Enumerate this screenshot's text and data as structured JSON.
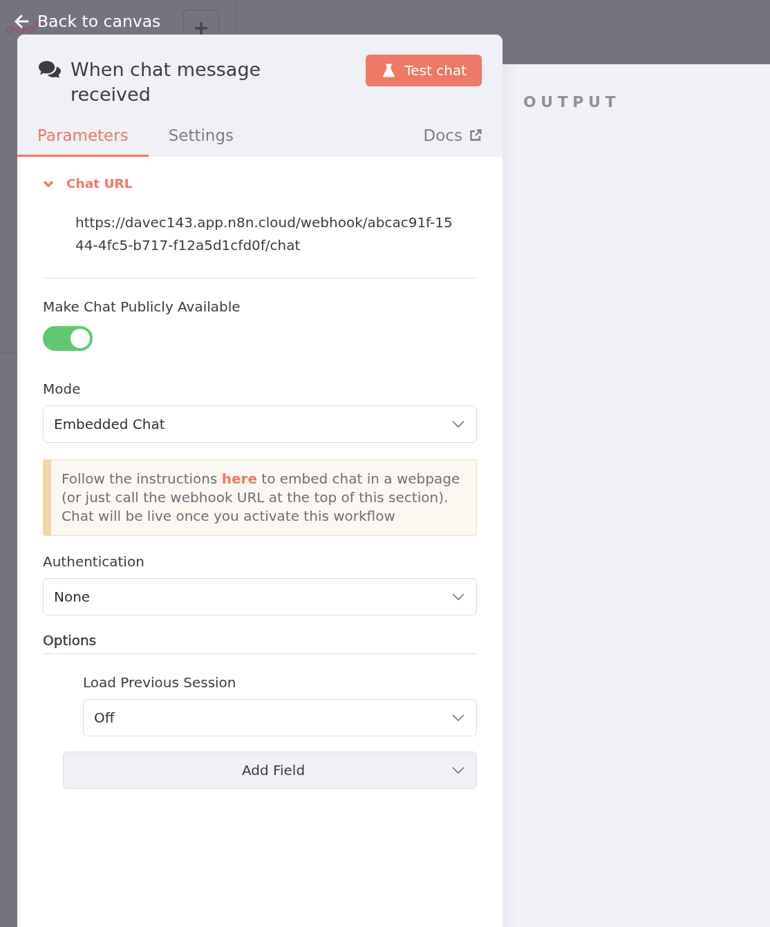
{
  "top_bar": {
    "back_link": "Back to canvas"
  },
  "node": {
    "title": "When chat message received",
    "test_button": "Test chat",
    "tabs": [
      {
        "label": "Parameters",
        "selected": true
      },
      {
        "label": "Settings",
        "selected": false
      }
    ],
    "docs_link": "Docs"
  },
  "parameters": {
    "chat_url": {
      "label": "Chat URL",
      "expanded": true,
      "url": "https://davec143.app.n8n.cloud/webhook/abcac91f-1544-4fc5-b717-f12a5d1cfd0f/chat"
    },
    "fields": [
      {
        "kind": "toggle",
        "label": "Make Chat Publicly Available",
        "on": true
      },
      {
        "kind": "select",
        "label": "Mode",
        "value": "Embedded Chat"
      },
      {
        "kind": "notice",
        "text": "Follow the instructions ",
        "link": "here",
        "text_after": " to embed chat in a webpage (or just call the webhook URL at the top of this section). Chat will be live once you activate this workflow"
      },
      {
        "kind": "select",
        "label": "Authentication",
        "value": "None"
      }
    ],
    "options": {
      "label": "Options",
      "fields": [
        {
          "kind": "select",
          "label": "Load Previous Session",
          "value": "Off"
        }
      ],
      "add_field": "Add Field"
    }
  },
  "output": {
    "title": "OUTPUT"
  }
}
